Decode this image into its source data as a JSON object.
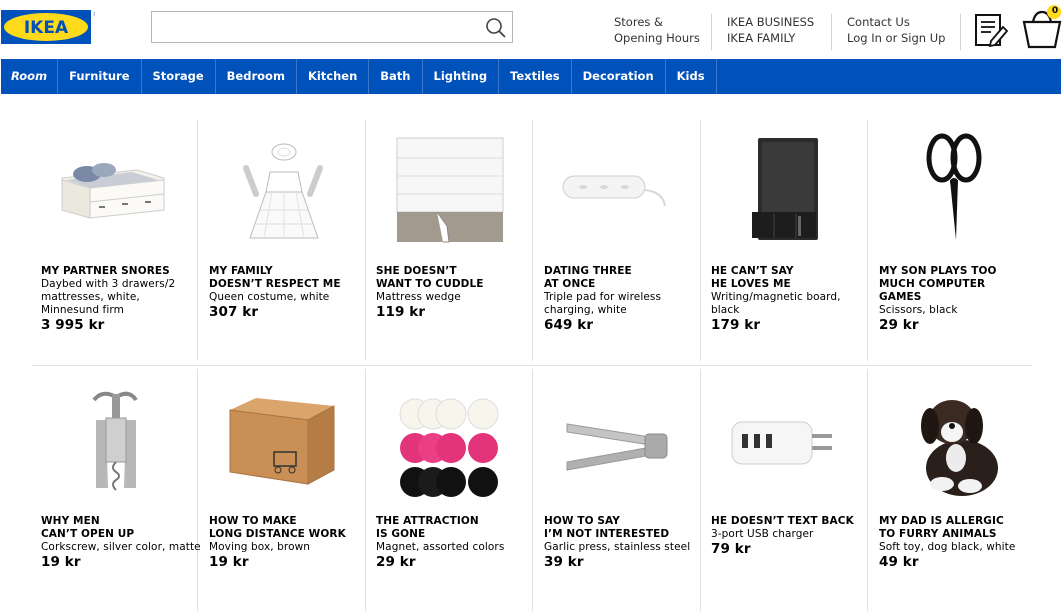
{
  "header": {
    "logo_text": "IKEA",
    "search_placeholder": "",
    "links": [
      {
        "line1": "Stores &",
        "line2": "Opening Hours"
      },
      {
        "line1": "IKEA BUSINESS",
        "line2": "IKEA FAMILY"
      },
      {
        "line1": "Contact Us",
        "line2": "Log In or Sign Up"
      }
    ],
    "cart_count": "0"
  },
  "nav": [
    "Room",
    "Furniture",
    "Storage",
    "Bedroom",
    "Kitchen",
    "Bath",
    "Lighting",
    "Textiles",
    "Decoration",
    "Kids"
  ],
  "products": [
    {
      "title": "MY PARTNER SNORES",
      "desc": "Daybed with 3 drawers/2 mattresses, white, Minnesund firm",
      "price": "3 995 kr",
      "icon": "daybed-icon"
    },
    {
      "title": "MY FAMILY\nDOESN’T RESPECT ME",
      "desc": "Queen costume, white",
      "price": "307 kr",
      "icon": "queen-costume-icon"
    },
    {
      "title": "SHE DOESN’T\nWANT TO CUDDLE",
      "desc": "Mattress wedge",
      "price": "119 kr",
      "icon": "mattress-wedge-icon"
    },
    {
      "title": "DATING THREE\nAT ONCE",
      "desc": "Triple pad for wireless charging, white",
      "price": "649 kr",
      "icon": "charging-pad-icon"
    },
    {
      "title": "HE CAN’T SAY\nHE LOVES ME",
      "desc": "Writing/magnetic board, black",
      "price": "179 kr",
      "icon": "magnetic-board-icon"
    },
    {
      "title": "MY SON PLAYS TOO\nMUCH COMPUTER\nGAMES",
      "desc": "Scissors, black",
      "price": "29 kr",
      "icon": "scissors-icon"
    },
    {
      "title": "WHY MEN\nCAN’T OPEN UP",
      "desc": "Corkscrew, silver color, matte",
      "price": "19 kr",
      "icon": "corkscrew-icon"
    },
    {
      "title": "HOW TO MAKE\nLONG DISTANCE WORK",
      "desc": "Moving box, brown",
      "price": "19 kr",
      "icon": "moving-box-icon"
    },
    {
      "title": "THE ATTRACTION\nIS GONE",
      "desc": "Magnet, assorted colors",
      "price": "29 kr",
      "icon": "magnets-icon"
    },
    {
      "title": "HOW TO SAY\nI’M NOT INTERESTED",
      "desc": "Garlic press, stainless steel",
      "price": "39 kr",
      "icon": "garlic-press-icon"
    },
    {
      "title": "HE DOESN’T TEXT BACK",
      "desc": "3-port USB charger",
      "price": "79 kr",
      "icon": "usb-charger-icon"
    },
    {
      "title": "MY DAD IS ALLERGIC\nTO FURRY ANIMALS",
      "desc": "Soft toy, dog black, white",
      "price": "49 kr",
      "icon": "soft-toy-dog-icon"
    }
  ],
  "colors": {
    "brand_blue": "#0051ba",
    "brand_yellow": "#ffda1a",
    "nav_text": "#ffffff"
  }
}
